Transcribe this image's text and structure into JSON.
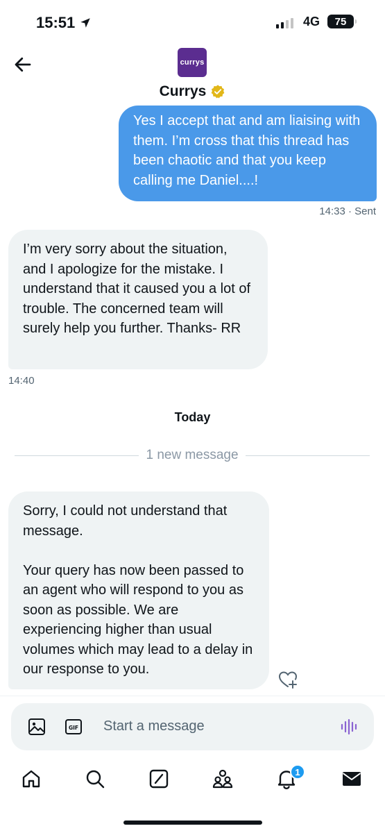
{
  "status_bar": {
    "time": "15:51",
    "network": "4G",
    "battery": "75"
  },
  "header": {
    "logo_text": "currys",
    "name": "Currys",
    "verified_color": "#e2b719"
  },
  "messages": [
    {
      "direction": "sent",
      "text": "Yes I accept that and am liaising with them. I’m cross that this thread has been chaotic and that you keep calling me Daniel....!",
      "meta": "14:33 · Sent"
    },
    {
      "direction": "received",
      "text": "I’m very sorry about the situation, and I apologize for the mistake. I understand that it caused you a lot of trouble. The concerned team will surely help you further. Thanks- RR",
      "meta": "14:40"
    },
    {
      "direction": "received",
      "para1": "Sorry, I could not understand that message.",
      "para2": "Your query has now been passed to an agent who will respond to you as soon as possible. We are experiencing higher than usual volumes which may lead to a delay in our response to you."
    }
  ],
  "divider": {
    "today": "Today",
    "new_message": "1 new message"
  },
  "composer": {
    "placeholder": "Start a message"
  },
  "tabbar": {
    "notifications_badge": "1"
  },
  "colors": {
    "sent_bubble": "#4a99e9",
    "received_bubble": "#eff3f4",
    "accent": "#1d9bf0",
    "brand": "#5b2d90",
    "voice": "#8a63d2"
  }
}
